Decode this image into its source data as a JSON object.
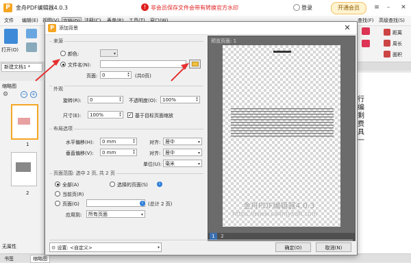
{
  "app": {
    "title": "金舟PDF编辑器4.0.3",
    "notice": "非会员保存文件会带有转换官方水印",
    "login": "登录",
    "vip": "开通会员"
  },
  "menu": {
    "items": [
      "文件",
      "编辑(E)",
      "视图(V)",
      "文档(D)",
      "注释(C)",
      "表单(R)",
      "工具(T)",
      "窗口(W)",
      "查找(F)",
      "高级查找(S)"
    ]
  },
  "ribbon": {
    "open_label": "打开(O)",
    "right_items": [
      "距离",
      "周长",
      "面积"
    ]
  },
  "doc_tab": "新建文档1 *",
  "left_panel": {
    "title": "缩略图",
    "page_labels": [
      "1",
      "2"
    ],
    "attr_label": "无属性"
  },
  "right_doc_text": [
    "行编",
    "剩",
    "费",
    "具",
    "一"
  ],
  "status": {
    "tabs": [
      "书签",
      "缩略图"
    ]
  },
  "dialog": {
    "title": "添加背景",
    "source": {
      "section_label": "来源",
      "color_label": "颜色:",
      "file_label": "文件名(N):",
      "file_value": "",
      "page_label": "页面:",
      "page_value": "0",
      "page_total": "(共0页)"
    },
    "appearance": {
      "section_label": "外观",
      "rotate_label": "旋转(R):",
      "rotate_value": "0",
      "opacity_label": "不透明度(O):",
      "opacity_value": "100%",
      "size_label": "尺寸(E):",
      "size_value": "100%",
      "scale_check_label": "基于目标页面缩放"
    },
    "layout": {
      "section_label": "布局选项",
      "h_offset_label": "水平偏移(H):",
      "h_offset_value": "0 mm",
      "h_align_label": "对齐:",
      "h_align_value": "居中",
      "v_offset_label": "垂直偏移(V):",
      "v_offset_value": "0 mm",
      "v_align_label": "对齐:",
      "v_align_value": "居中",
      "unit_label": "单位(U):",
      "unit_value": "毫米"
    },
    "page_range": {
      "section_label": "页面范围: 选中 2 页, 共 2 页",
      "all_label": "全部(A)",
      "selected_label": "选择的页面(S)",
      "current_label": "当前页(R)",
      "pages_label": "页面(G)",
      "pages_total": "(总计 2 页)",
      "apply_label": "应用到:",
      "apply_value": "所有页面"
    },
    "preview": {
      "title": "预览页面: 1",
      "pages": [
        "1",
        "2"
      ],
      "watermark_line1": "金舟PDF编辑器4.0.3",
      "watermark_line2": "https://www.callmysoft.com"
    },
    "settings_label": "设置: <自定义>",
    "ok_label": "确定(O)",
    "cancel_label": "取消(N)"
  }
}
